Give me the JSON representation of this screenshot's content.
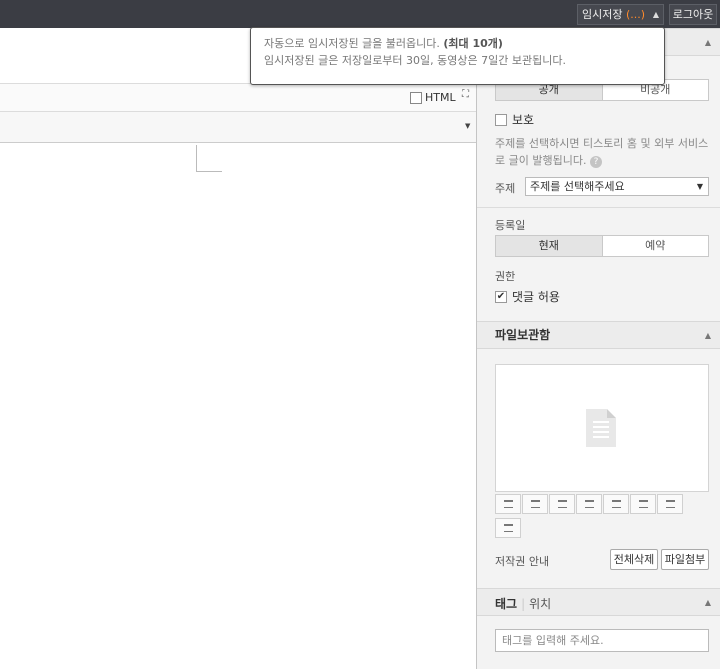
{
  "topbar": {
    "temp_save_label": "임시저장",
    "temp_save_count": "(...)",
    "logout_label": "로그아웃"
  },
  "tooltip": {
    "line1": "자동으로 임시저장된 글을 불러옵니다.",
    "line1_strong": "(최대 10개)",
    "line2": "임시저장된 글은 저장일로부터 30일, 동영상은 7일간 보관됩니다."
  },
  "editor": {
    "html_label": "HTML"
  },
  "sidebar": {
    "visibility": {
      "public": "공개",
      "private": "비공개"
    },
    "protect_label": "보호",
    "note": "주제를 선택하시면 티스토리 홈 및 외부 서비스로 글이 발행됩니다.",
    "topic_label": "주제",
    "topic_value": "주제를 선택해주세요",
    "date_label": "등록일",
    "date_now": "현재",
    "date_reserve": "예약",
    "perm_label": "권한",
    "comment_label": "댓글 허용",
    "file_section": "파일보관함",
    "copyright_label": "저작권 안내",
    "delete_all": "전체삭제",
    "attach_file": "파일첨부",
    "tag_tab": "태그",
    "location_tab": "위치",
    "tag_placeholder": "태그를 입력해 주세요."
  }
}
